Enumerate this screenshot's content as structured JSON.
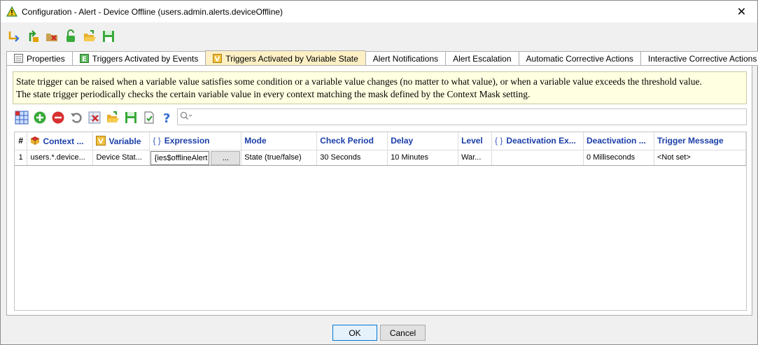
{
  "window": {
    "title": "Configuration - Alert - Device Offline (users.admin.alerts.deviceOffline)",
    "close_glyph": "✕"
  },
  "top_toolbar": {
    "icons": [
      "reload-icon",
      "commit-icon",
      "delete-icon",
      "unlock-icon",
      "open-folder-icon",
      "save-icon"
    ]
  },
  "tabs": [
    {
      "label": "Properties",
      "icon": "properties-icon",
      "active": false
    },
    {
      "label": "Triggers Activated by Events",
      "icon": "event-icon",
      "active": false
    },
    {
      "label": "Triggers Activated by Variable State",
      "icon": "variable-icon",
      "active": true
    },
    {
      "label": "Alert Notifications",
      "icon": "",
      "active": false
    },
    {
      "label": "Alert Escalation",
      "icon": "",
      "active": false
    },
    {
      "label": "Automatic Corrective Actions",
      "icon": "",
      "active": false
    },
    {
      "label": "Interactive Corrective Actions",
      "icon": "",
      "active": false
    }
  ],
  "info": {
    "line1": "State trigger can be raised when a variable value satisfies some condition or a variable value changes (no matter to what value), or when a variable value exceeds the threshold value.",
    "line2": "The state trigger periodically checks the certain variable value in every context matching the mask defined by the Context Mask setting."
  },
  "grid_toolbar": {
    "icons": [
      "table-icon",
      "add-icon",
      "remove-icon",
      "undo-icon",
      "clear-icon",
      "open-folder-icon",
      "save-icon",
      "validate-icon",
      "help-icon"
    ]
  },
  "search": {
    "placeholder": "",
    "icon": "search-icon"
  },
  "table": {
    "headers": {
      "num": "#",
      "context": "Context ...",
      "variable": "Variable",
      "expression": "Expression",
      "mode": "Mode",
      "check_period": "Check Period",
      "delay": "Delay",
      "level": "Level",
      "deactivation_expr": "Deactivation Ex...",
      "deactivation_delay": "Deactivation ...",
      "trigger_message": "Trigger Message"
    },
    "brace_glyph": "{ }",
    "rows": [
      {
        "num": "1",
        "context": "users.*.device...",
        "variable": "Device Stat...",
        "expression": "ies$offlineAlert}",
        "expression_button": "...",
        "mode": "State (true/false)",
        "check_period": "30 Seconds",
        "delay": "10 Minutes",
        "level": "War...",
        "deactivation_expr": "",
        "deactivation_delay": "0 Milliseconds",
        "trigger_message": "<Not set>"
      }
    ]
  },
  "buttons": {
    "ok": "OK",
    "cancel": "Cancel"
  },
  "colors": {
    "header_text": "#1a3ea8",
    "active_tab": "#fdf0c5",
    "info_bg": "#ffffe1"
  }
}
